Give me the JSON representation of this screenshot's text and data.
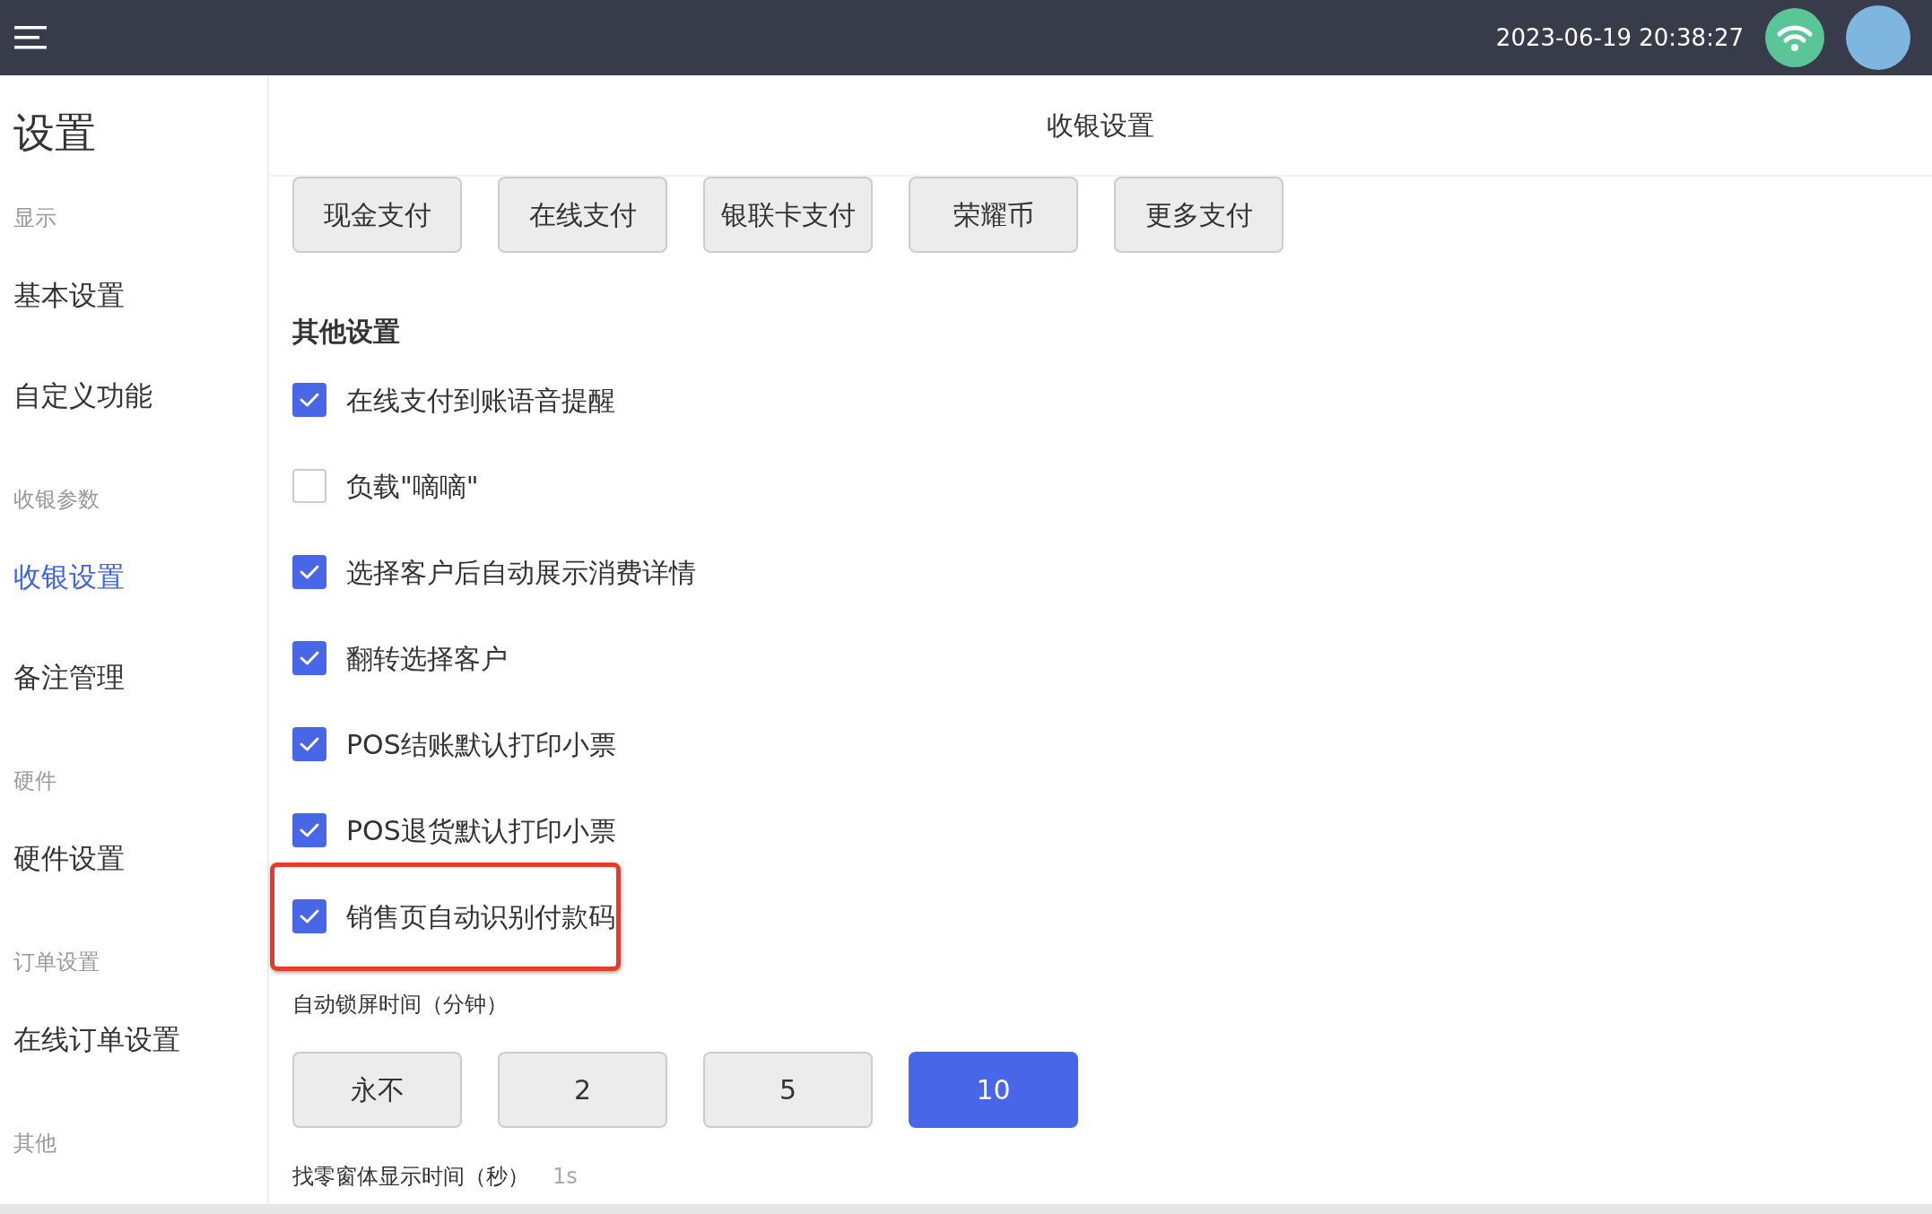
{
  "top_bar": {
    "datetime": "2023-06-19 20:38:27"
  },
  "sidebar": {
    "title": "设置",
    "sections": [
      {
        "label": "显示",
        "items": [
          {
            "label": "基本设置",
            "selected": false
          },
          {
            "label": "自定义功能",
            "selected": false
          }
        ]
      },
      {
        "label": "收银参数",
        "items": [
          {
            "label": "收银设置",
            "selected": true
          },
          {
            "label": "备注管理",
            "selected": false
          }
        ]
      },
      {
        "label": "硬件",
        "items": [
          {
            "label": "硬件设置",
            "selected": false
          }
        ]
      },
      {
        "label": "订单设置",
        "items": [
          {
            "label": "在线订单设置",
            "selected": false
          }
        ]
      },
      {
        "label": "其他"
      }
    ]
  },
  "page_title": "收银设置",
  "payment_buttons": [
    "现金支付",
    "在线支付",
    "银联卡支付",
    "荣耀币",
    "更多支付"
  ],
  "other_settings": {
    "heading": "其他设置",
    "options": [
      {
        "label": "在线支付到账语音提醒",
        "checked": true,
        "highlighted": false
      },
      {
        "label": "负载\"嘀嘀\"",
        "checked": false,
        "highlighted": false
      },
      {
        "label": "选择客户后自动展示消费详情",
        "checked": true,
        "highlighted": false
      },
      {
        "label": "翻转选择客户",
        "checked": true,
        "highlighted": false
      },
      {
        "label": "POS结账默认打印小票",
        "checked": true,
        "highlighted": false
      },
      {
        "label": "POS退货默认打印小票",
        "checked": true,
        "highlighted": false
      },
      {
        "label": "销售页自动识别付款码",
        "checked": true,
        "highlighted": true
      }
    ]
  },
  "lock_time": {
    "label": "自动锁屏时间（分钟）",
    "options": [
      {
        "label": "永不",
        "selected": false
      },
      {
        "label": "2",
        "selected": false
      },
      {
        "label": "5",
        "selected": false
      },
      {
        "label": "10",
        "selected": true
      }
    ]
  },
  "change_window_time": {
    "label": "找零窗体显示时间（秒）",
    "value": "1s"
  }
}
